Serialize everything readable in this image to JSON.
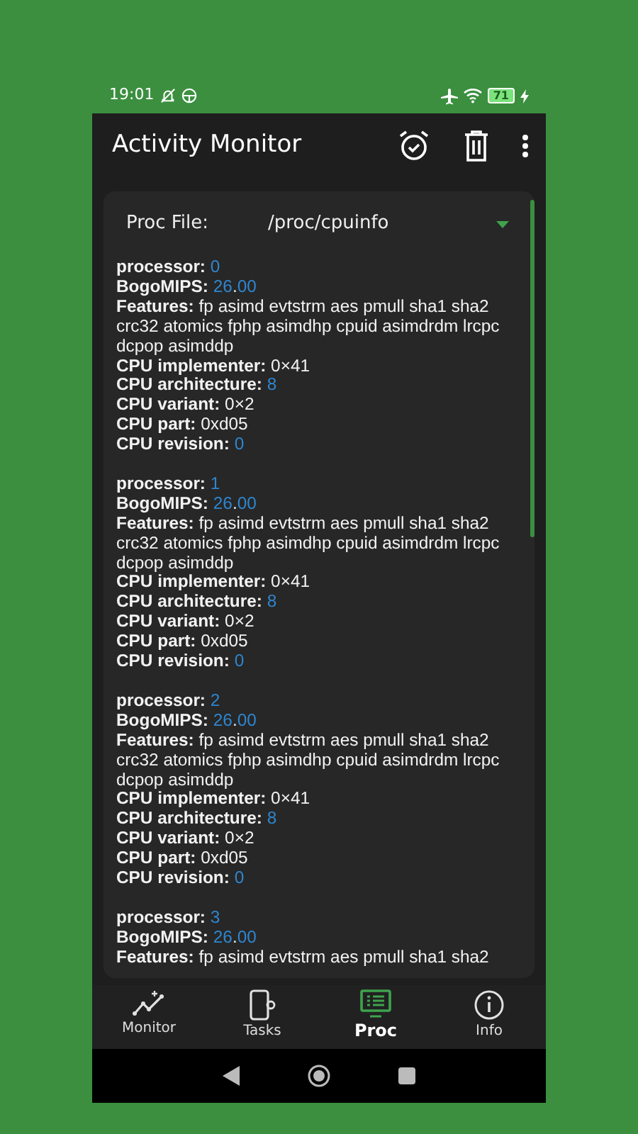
{
  "status_bar": {
    "time": "19:01",
    "battery": "71"
  },
  "app_bar": {
    "title": "Activity Monitor"
  },
  "proc_file": {
    "label": "Proc File:",
    "value": "/proc/cpuinfo"
  },
  "blocks": [
    {
      "lines": [
        {
          "key": "processor:",
          "parts": [
            {
              "text": "0",
              "kind": "number"
            }
          ]
        },
        {
          "key": "BogoMIPS:",
          "parts": [
            {
              "text": "26",
              "kind": "number"
            },
            {
              "text": ".",
              "kind": "text"
            },
            {
              "text": "00",
              "kind": "number"
            }
          ]
        },
        {
          "key": "Features:",
          "parts": [
            {
              "text": "fp asimd evtstrm aes pmull sha1 sha2 crc32 atomics fphp asimdhp cpuid asimdrdm lrcpc dcpop asimddp",
              "kind": "text"
            }
          ]
        },
        {
          "key": "CPU implementer:",
          "parts": [
            {
              "text": "0×41",
              "kind": "text"
            }
          ]
        },
        {
          "key": "CPU architecture:",
          "parts": [
            {
              "text": "8",
              "kind": "number"
            }
          ]
        },
        {
          "key": "CPU variant:",
          "parts": [
            {
              "text": "0×2",
              "kind": "text"
            }
          ]
        },
        {
          "key": "CPU part:",
          "parts": [
            {
              "text": "0xd05",
              "kind": "text"
            }
          ]
        },
        {
          "key": "CPU revision:",
          "parts": [
            {
              "text": "0",
              "kind": "number"
            }
          ]
        }
      ]
    },
    {
      "lines": [
        {
          "key": "processor:",
          "parts": [
            {
              "text": "1",
              "kind": "number"
            }
          ]
        },
        {
          "key": "BogoMIPS:",
          "parts": [
            {
              "text": "26",
              "kind": "number"
            },
            {
              "text": ".",
              "kind": "text"
            },
            {
              "text": "00",
              "kind": "number"
            }
          ]
        },
        {
          "key": "Features:",
          "parts": [
            {
              "text": "fp asimd evtstrm aes pmull sha1 sha2 crc32 atomics fphp asimdhp cpuid asimdrdm lrcpc dcpop asimddp",
              "kind": "text"
            }
          ]
        },
        {
          "key": "CPU implementer:",
          "parts": [
            {
              "text": "0×41",
              "kind": "text"
            }
          ]
        },
        {
          "key": "CPU architecture:",
          "parts": [
            {
              "text": "8",
              "kind": "number"
            }
          ]
        },
        {
          "key": "CPU variant:",
          "parts": [
            {
              "text": "0×2",
              "kind": "text"
            }
          ]
        },
        {
          "key": "CPU part:",
          "parts": [
            {
              "text": "0xd05",
              "kind": "text"
            }
          ]
        },
        {
          "key": "CPU revision:",
          "parts": [
            {
              "text": "0",
              "kind": "number"
            }
          ]
        }
      ]
    },
    {
      "lines": [
        {
          "key": "processor:",
          "parts": [
            {
              "text": "2",
              "kind": "number"
            }
          ]
        },
        {
          "key": "BogoMIPS:",
          "parts": [
            {
              "text": "26",
              "kind": "number"
            },
            {
              "text": ".",
              "kind": "text"
            },
            {
              "text": "00",
              "kind": "number"
            }
          ]
        },
        {
          "key": "Features:",
          "parts": [
            {
              "text": "fp asimd evtstrm aes pmull sha1 sha2 crc32 atomics fphp asimdhp cpuid asimdrdm lrcpc dcpop asimddp",
              "kind": "text"
            }
          ]
        },
        {
          "key": "CPU implementer:",
          "parts": [
            {
              "text": "0×41",
              "kind": "text"
            }
          ]
        },
        {
          "key": "CPU architecture:",
          "parts": [
            {
              "text": "8",
              "kind": "number"
            }
          ]
        },
        {
          "key": "CPU variant:",
          "parts": [
            {
              "text": "0×2",
              "kind": "text"
            }
          ]
        },
        {
          "key": "CPU part:",
          "parts": [
            {
              "text": "0xd05",
              "kind": "text"
            }
          ]
        },
        {
          "key": "CPU revision:",
          "parts": [
            {
              "text": "0",
              "kind": "number"
            }
          ]
        }
      ]
    },
    {
      "lines": [
        {
          "key": "processor:",
          "parts": [
            {
              "text": "3",
              "kind": "number"
            }
          ]
        },
        {
          "key": "BogoMIPS:",
          "parts": [
            {
              "text": "26",
              "kind": "number"
            },
            {
              "text": ".",
              "kind": "text"
            },
            {
              "text": "00",
              "kind": "number"
            }
          ]
        },
        {
          "key": "Features:",
          "parts": [
            {
              "text": "fp asimd evtstrm aes pmull sha1 sha2",
              "kind": "text"
            }
          ]
        }
      ]
    }
  ],
  "bottom_nav": [
    {
      "label": "Monitor",
      "selected": false
    },
    {
      "label": "Tasks",
      "selected": false
    },
    {
      "label": "Proc",
      "selected": true
    },
    {
      "label": "Info",
      "selected": false
    }
  ]
}
